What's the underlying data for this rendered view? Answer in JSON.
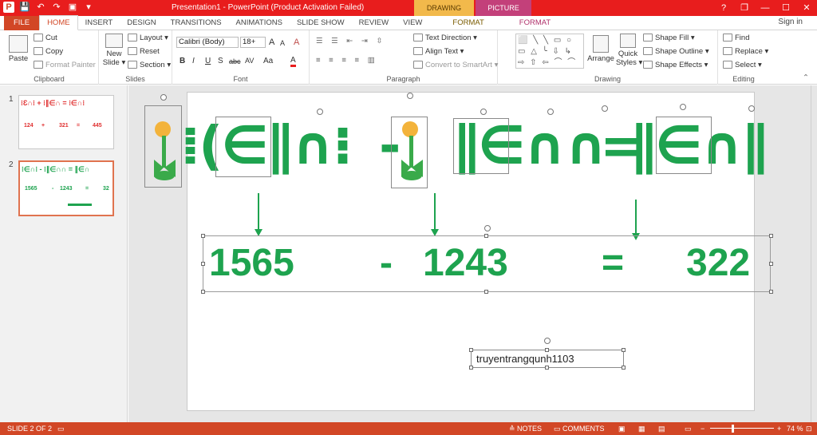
{
  "window": {
    "title": "Presentation1 - PowerPoint (Product Activation Failed)",
    "context_drawing": "DRAWING TOOLS",
    "context_picture": "PICTURE TOOLS",
    "help": "?",
    "restore": "❐",
    "minimize": "—",
    "maximize": "☐",
    "close": "✕",
    "signin": "Sign in"
  },
  "qat": {
    "app": "P",
    "save": "💾",
    "undo": "↶",
    "redo": "↷",
    "start": "▣",
    "more": "▾"
  },
  "tabs": [
    "FILE",
    "HOME",
    "INSERT",
    "DESIGN",
    "TRANSITIONS",
    "ANIMATIONS",
    "SLIDE SHOW",
    "REVIEW",
    "VIEW",
    "FORMAT",
    "FORMAT"
  ],
  "ribbon": {
    "clipboard": {
      "label": "Clipboard",
      "paste": "Paste",
      "cut": "Cut",
      "copy": "Copy",
      "format_painter": "Format Painter"
    },
    "slides": {
      "label": "Slides",
      "new_slide": "New",
      "new_slide2": "Slide ▾",
      "layout": "Layout ▾",
      "reset": "Reset",
      "section": "Section ▾"
    },
    "font": {
      "label": "Font",
      "font_name": "Calibri (Body)",
      "font_size": "18+",
      "grow": "A",
      "shrink": "A",
      "clear": "A",
      "bold": "B",
      "italic": "I",
      "underline": "U",
      "shadow": "S",
      "strike": "abc",
      "spacing": "AV",
      "case": "Aa",
      "color": "A"
    },
    "paragraph": {
      "label": "Paragraph",
      "text_direction": "Text Direction ▾",
      "align_text": "Align Text ▾",
      "smartart": "Convert to SmartArt ▾"
    },
    "drawing": {
      "label": "Drawing",
      "shapes": "⬜ ╲ ╲ ▭ ○ ▭ △ ╰ ⇩ ↳ ⇨ ⇧ ⇦ ⌒ ⌒ ( ) { } ☆",
      "arrange": "Arrange",
      "quick_styles": "Quick",
      "quick_styles2": "Styles ▾",
      "shape_fill": "Shape Fill ▾",
      "shape_outline": "Shape Outline ▾",
      "shape_effects": "Shape Effects ▾"
    },
    "editing": {
      "label": "Editing",
      "find": "Find",
      "replace": "Replace ▾",
      "select": "Select ▾"
    }
  },
  "thumbnails": [
    {
      "num": "1",
      "glyphs": "⁝Ɛ∩⁝ + ⁝∥∈∩ = ⁝∈∩⁝",
      "numbers": [
        "124",
        "+",
        "321",
        "=",
        "445"
      ]
    },
    {
      "num": "2",
      "glyphs": "⁝∈∩⁝ - ⁝∥∈∩∩ = ∥∈∩",
      "numbers": [
        "1565",
        "-",
        "1243",
        "=",
        "32"
      ]
    }
  ],
  "slide": {
    "glyph_row_1": "⁞(∈∥∩⁝",
    "glyph_row_2": "-",
    "glyph_row_3": "∥∈∩∩",
    "glyph_row_4": "=",
    "glyph_row_5": "∥∈∩∥",
    "numbers": {
      "a": "1565",
      "op": "-",
      "b": "1243",
      "eq": "=",
      "result": "322"
    },
    "author": "truyentrangqunh1103"
  },
  "colors": {
    "green": "#1ea34f",
    "ribbon_red": "#d24726",
    "title_red": "#e81d1d",
    "flower_orange": "#f3b33b"
  },
  "status": {
    "slide": "SLIDE 2 OF 2",
    "notes": "NOTES",
    "comments": "COMMENTS",
    "zoom": "74 %",
    "zoom_minus": "−",
    "zoom_plus": "+"
  }
}
